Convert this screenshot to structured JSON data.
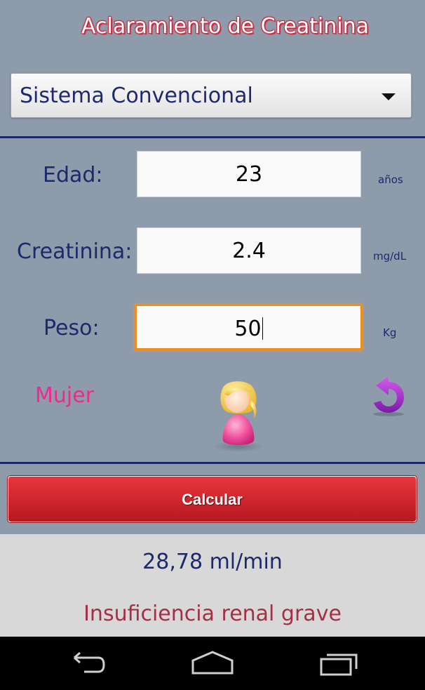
{
  "app": {
    "title": "Aclaramiento de Creatinina"
  },
  "units_system": {
    "selected": "Sistema Convencional"
  },
  "fields": {
    "age": {
      "label": "Edad:",
      "value": "23",
      "unit": "años"
    },
    "creatinine": {
      "label": "Creatinina:",
      "value": "2.4",
      "unit": "mg/dL"
    },
    "weight": {
      "label": "Peso:",
      "value": "50",
      "unit": "Kg"
    }
  },
  "gender": {
    "label": "Mujer",
    "icon": "female-avatar-icon"
  },
  "actions": {
    "calculate_label": "Calcular",
    "reset_icon": "refresh-icon"
  },
  "result": {
    "value": "28,78 ml/min",
    "diagnosis": "Insuficiencia renal grave"
  },
  "navbar": {
    "icons": [
      "back-icon",
      "home-icon",
      "recent-apps-icon"
    ]
  },
  "colors": {
    "background": "#8e9bab",
    "divider": "#1c2a6b",
    "label_text": "#1c2a6b",
    "gender_pink": "#ee2a91",
    "button_red": "#d52a31",
    "focus_orange": "#f08c1c",
    "diagnosis_text": "#a52f45"
  }
}
